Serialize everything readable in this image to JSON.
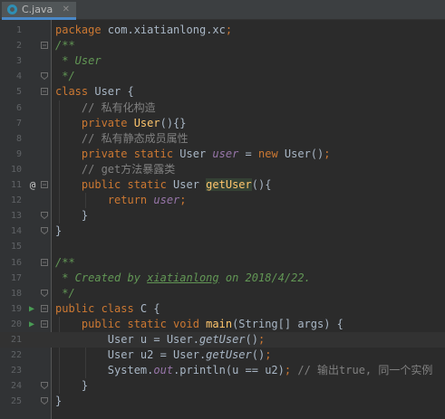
{
  "colors": {
    "background": "#2b2b2b",
    "gutter": "#313335",
    "keyword": "#cc7832",
    "text": "#a9b7c6",
    "doc_comment": "#629755",
    "line_comment": "#808080",
    "static_field": "#9876aa",
    "method_declaration": "#ffc66d",
    "run_marker": "#499c54",
    "tab_underline": "#4a88c7"
  },
  "tab": {
    "label": "C.java",
    "icon": "java-class-icon",
    "close_glyph": "✕"
  },
  "editor": {
    "current_line": 21,
    "lines": [
      {
        "number": "1",
        "marker": "",
        "fold": "",
        "tokens": [
          {
            "text": "package",
            "style": "kw"
          },
          {
            "text": " com.xiatianlong.xc",
            "style": "plain"
          },
          {
            "text": ";",
            "style": "kw"
          }
        ]
      },
      {
        "number": "2",
        "marker": "",
        "fold": "open",
        "tokens": [
          {
            "text": "/**",
            "style": "doc"
          }
        ]
      },
      {
        "number": "3",
        "marker": "",
        "fold": "",
        "tokens": [
          {
            "text": " * User",
            "style": "doc"
          }
        ]
      },
      {
        "number": "4",
        "marker": "",
        "fold": "close",
        "tokens": [
          {
            "text": " */",
            "style": "doc"
          }
        ]
      },
      {
        "number": "5",
        "marker": "",
        "fold": "open",
        "tokens": [
          {
            "text": "class",
            "style": "kw"
          },
          {
            "text": " User {",
            "style": "plain"
          }
        ]
      },
      {
        "number": "6",
        "marker": "",
        "fold": "",
        "tokens": [
          {
            "text": "    // 私有化构造",
            "style": "cmt"
          }
        ]
      },
      {
        "number": "7",
        "marker": "",
        "fold": "",
        "tokens": [
          {
            "text": "    private ",
            "style": "kw"
          },
          {
            "text": "User",
            "style": "mth"
          },
          {
            "text": "(){}",
            "style": "plain"
          }
        ]
      },
      {
        "number": "8",
        "marker": "",
        "fold": "",
        "tokens": [
          {
            "text": "    // 私有静态成员属性",
            "style": "cmt"
          }
        ]
      },
      {
        "number": "9",
        "marker": "",
        "fold": "",
        "tokens": [
          {
            "text": "    private static ",
            "style": "kw"
          },
          {
            "text": "User ",
            "style": "plain"
          },
          {
            "text": "user",
            "style": "fld"
          },
          {
            "text": " = ",
            "style": "plain"
          },
          {
            "text": "new ",
            "style": "kw"
          },
          {
            "text": "User()",
            "style": "plain"
          },
          {
            "text": ";",
            "style": "kw"
          }
        ]
      },
      {
        "number": "10",
        "marker": "",
        "fold": "",
        "tokens": [
          {
            "text": "    // get方法暴露类",
            "style": "cmt"
          }
        ]
      },
      {
        "number": "11",
        "marker": "@",
        "fold": "open",
        "tokens": [
          {
            "text": "    public static ",
            "style": "kw"
          },
          {
            "text": "User ",
            "style": "plain"
          },
          {
            "text": "getUser",
            "style": "mth-hl"
          },
          {
            "text": "(){",
            "style": "plain"
          }
        ]
      },
      {
        "number": "12",
        "marker": "",
        "fold": "",
        "tokens": [
          {
            "text": "        return ",
            "style": "kw"
          },
          {
            "text": "user",
            "style": "fld"
          },
          {
            "text": ";",
            "style": "kw"
          }
        ]
      },
      {
        "number": "13",
        "marker": "",
        "fold": "close",
        "tokens": [
          {
            "text": "    }",
            "style": "plain"
          }
        ]
      },
      {
        "number": "14",
        "marker": "",
        "fold": "close",
        "tokens": [
          {
            "text": "}",
            "style": "plain"
          }
        ]
      },
      {
        "number": "15",
        "marker": "",
        "fold": "",
        "tokens": []
      },
      {
        "number": "16",
        "marker": "",
        "fold": "open",
        "tokens": [
          {
            "text": "/**",
            "style": "doc"
          }
        ]
      },
      {
        "number": "17",
        "marker": "",
        "fold": "",
        "tokens": [
          {
            "text": " * Created by ",
            "style": "doc"
          },
          {
            "text": "xiatianlong",
            "style": "doc-u"
          },
          {
            "text": " on 2018/4/22.",
            "style": "doc"
          }
        ]
      },
      {
        "number": "18",
        "marker": "",
        "fold": "close",
        "tokens": [
          {
            "text": " */",
            "style": "doc"
          }
        ]
      },
      {
        "number": "19",
        "marker": "run",
        "fold": "open",
        "tokens": [
          {
            "text": "public class ",
            "style": "kw"
          },
          {
            "text": "C {",
            "style": "plain"
          }
        ]
      },
      {
        "number": "20",
        "marker": "run",
        "fold": "open",
        "tokens": [
          {
            "text": "    public static void ",
            "style": "kw"
          },
          {
            "text": "main",
            "style": "mth"
          },
          {
            "text": "(String[] args) {",
            "style": "plain"
          }
        ]
      },
      {
        "number": "21",
        "marker": "",
        "fold": "",
        "tokens": [
          {
            "text": "        User u = User.",
            "style": "plain"
          },
          {
            "text": "getUser",
            "style": "smth"
          },
          {
            "text": "()",
            "style": "plain"
          },
          {
            "text": ";",
            "style": "kw"
          }
        ]
      },
      {
        "number": "22",
        "marker": "",
        "fold": "",
        "tokens": [
          {
            "text": "        User u2 = User.",
            "style": "plain"
          },
          {
            "text": "getUser",
            "style": "smth"
          },
          {
            "text": "()",
            "style": "plain"
          },
          {
            "text": ";",
            "style": "kw"
          }
        ]
      },
      {
        "number": "23",
        "marker": "",
        "fold": "",
        "tokens": [
          {
            "text": "        System.",
            "style": "plain"
          },
          {
            "text": "out",
            "style": "fld"
          },
          {
            "text": ".println(u == u2)",
            "style": "plain"
          },
          {
            "text": "; ",
            "style": "kw"
          },
          {
            "text": "// 输出true, 同一个实例",
            "style": "cmt"
          }
        ]
      },
      {
        "number": "24",
        "marker": "",
        "fold": "close",
        "tokens": [
          {
            "text": "    }",
            "style": "plain"
          }
        ]
      },
      {
        "number": "25",
        "marker": "",
        "fold": "close",
        "tokens": [
          {
            "text": "}",
            "style": "plain"
          }
        ]
      }
    ]
  }
}
